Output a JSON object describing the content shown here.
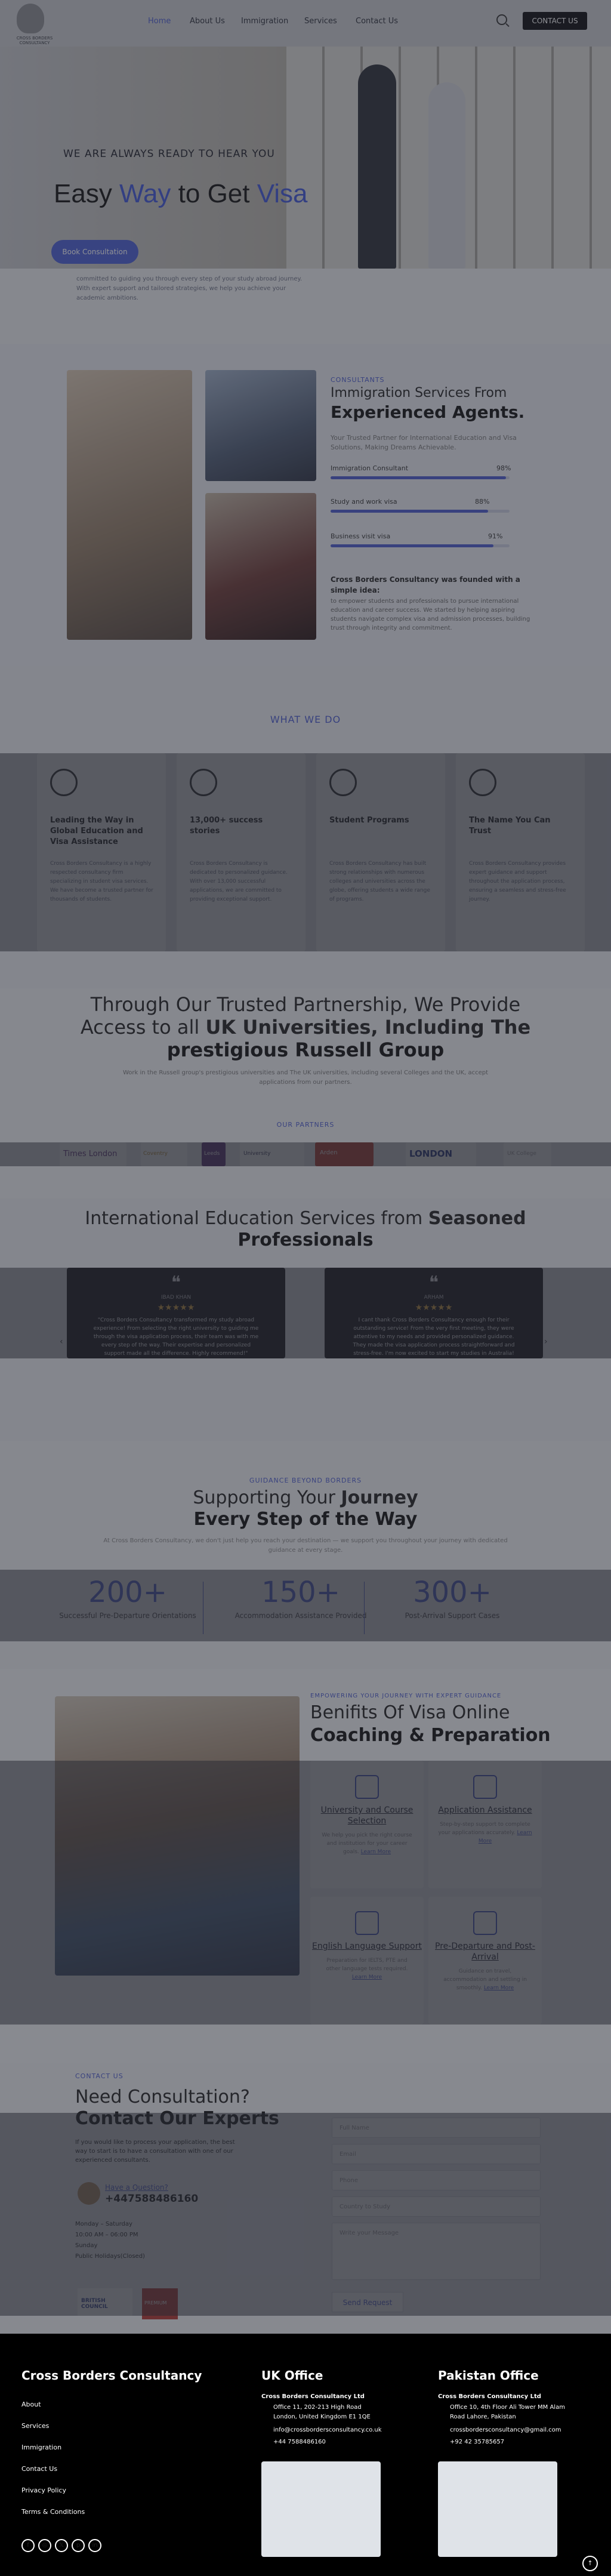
{
  "header": {
    "logo_text": "CROSS BORDERS CONSULTANCY",
    "nav": [
      "Home",
      "About Us",
      "Immigration",
      "Services",
      "Contact Us"
    ],
    "cta": "CONTACT US"
  },
  "hero": {
    "subtitle": "WE ARE ALWAYS READY TO HEAR YOU",
    "title_1": "Easy ",
    "title_2": "Way",
    "title_3": " to Get ",
    "title_4": "Visa",
    "button": "Book Consultation",
    "para": "committed to guiding you through every step of your study abroad journey. With expert support and tailored strategies, we help you achieve your academic ambitions."
  },
  "consultants": {
    "kicker": "CONSULTANTS",
    "title": "Immigration Services From",
    "title_bold": "Experienced Agents.",
    "sub": "Your Trusted Partner for International Education and Visa Solutions, Making Dreams Achievable.",
    "bars": [
      {
        "label": "Immigration Consultant",
        "pct": "98%",
        "value": 0.98
      },
      {
        "label": "Study and work visa",
        "pct": "88%",
        "value": 0.88
      },
      {
        "label": "Business visit visa",
        "pct": "91%",
        "value": 0.91
      }
    ],
    "founded": "Cross Borders Consultancy was founded with a simple idea:",
    "about": "to empower students and professionals to pursue international education and career success. We started by helping aspiring students navigate complex visa and admission processes, building trust through integrity and commitment."
  },
  "whatwedo": {
    "kicker": "WHAT WE DO",
    "cards": [
      {
        "title": "Leading the Way in Global Education and Visa Assistance",
        "text": "Cross Borders Consultancy is a highly respected consultancy firm specializing in student visa services. We have become a trusted partner for thousands of students."
      },
      {
        "title": "13,000+ success stories",
        "text": "Cross Borders Consultancy is dedicated to personalized guidance. With over 13,000 successful applications, we are committed to providing exceptional support."
      },
      {
        "title": "Student Programs",
        "text": "Cross Borders Consultancy has built strong relationships with numerous colleges and universities across the globe, offering students a wide range of programs."
      },
      {
        "title": "The Name You Can Trust",
        "text": "Cross Borders Consultancy provides expert guidance and support throughout the application process, ensuring a seamless and stress-free journey."
      }
    ]
  },
  "partners": {
    "line1": "Through Our Trusted Partnership, We Provide",
    "line2a": "Access to all ",
    "line2b": "UK Universities, Including The",
    "line3": "prestigious Russell Group",
    "sub": "Work in the Russell group's prestigious universities and The UK universities, including several Colleges and the UK, accept applications from our partners.",
    "kicker": "OUR PARTNERS",
    "logos": [
      "Times London",
      "Coventry",
      "Leeds",
      "University",
      "Arden",
      "LONDON",
      "UK College"
    ]
  },
  "testimonials": {
    "title_a": "International Education Services from ",
    "title_b": "Seasoned",
    "title_c": "Professionals",
    "items": [
      {
        "name": "IBAD KHAN",
        "stars": "★★★★★",
        "text": "\"Cross Borders Consultancy transformed my study abroad experience! From selecting the right university to guiding me through the visa application process, their team was with me every step of the way. Their expertise and personalized support made all the difference. Highly recommend!\""
      },
      {
        "name": "ARHAM",
        "stars": "★★★★★",
        "text": "I cant thank Cross Borders Consultancy enough for their outstanding service! From the very first meeting, they were attentive to my needs and provided personalized guidance. They made the visa application process straightforward and stress-free. I'm now excited to start my studies in Australia!"
      }
    ]
  },
  "stats": {
    "kicker": "GUIDANCE BEYOND BORDERS",
    "title_a": "Supporting Your ",
    "title_b": "Journey",
    "title_c": "Every Step of the Way",
    "sub": "At Cross Borders Consultancy, we don't just help you reach your destination — we support you throughout your journey with dedicated guidance at every stage.",
    "items": [
      {
        "num": "200+",
        "label": "Successful Pre-Departure Orientations"
      },
      {
        "num": "150+",
        "label": "Accommodation Assistance Provided"
      },
      {
        "num": "300+",
        "label": "Post-Arrival Support Cases"
      }
    ]
  },
  "benefits": {
    "kicker": "EMPOWERING YOUR JOURNEY WITH EXPERT GUIDANCE",
    "title": "Benifits Of Visa Online",
    "title_bold": "Coaching & Preparation",
    "items": [
      {
        "title": "University and Course Selection",
        "text": "We help you pick the right course and institution for your career goals.",
        "more": "Learn More"
      },
      {
        "title": "Application Assistance",
        "text": "Step-by-step support to complete your applications accurately.",
        "more": "Learn More"
      },
      {
        "title": "English Language Support",
        "text": "Preparation for IELTS, PTE and other language tests required.",
        "more": "Learn More"
      },
      {
        "title": "Pre-Departure and Post-Arrival",
        "text": "Guidance on travel, accommodation and settling in smoothly.",
        "more": "Learn More"
      }
    ]
  },
  "contact": {
    "kicker": "CONTACT US",
    "title": "Need Consultation?",
    "title_bold": "Contact Our Experts",
    "text": "If you would like to process your application, the best way to start is to have a consultation with one of our experienced consultants.",
    "have_q": "Have a Question?",
    "phone": "+447588486160",
    "hours_1": "Monday – Saturday",
    "hours_2": "10:00 AM – 06:00 PM",
    "hours_3": "Sunday",
    "hours_4": "Public Holidays(Closed)",
    "fields": [
      "Full Name",
      "Email",
      "Phone",
      "Country to Study",
      "Write your Message"
    ],
    "send": "Send Request",
    "badge1": "BRITISH COUNCIL",
    "badge2": "PREMIUM"
  },
  "footer": {
    "brand": "Cross Borders Consultancy",
    "links": [
      "About",
      "Services",
      "Immigration",
      "Contact Us",
      "Privacy Policy",
      "Terms & Conditions"
    ],
    "uk_title": "UK Office",
    "uk_name": "Cross Borders Consultancy Ltd",
    "uk_addr": "Office 11, 202-213 High Road London, United Kingdom E1 1QE",
    "uk_email": "info@crossbordersconsultancy.co.uk",
    "uk_phone": "+44 7588486160",
    "pk_title": "Pakistan Office",
    "pk_name": "Cross Borders Consultancy Ltd",
    "pk_addr": "Office 10, 4th Floor Ali Tower MM Alam Road Lahore, Pakistan",
    "pk_email": "crossbordersconsultancy@gmail.com",
    "pk_phone": "+92 42 35785657"
  }
}
